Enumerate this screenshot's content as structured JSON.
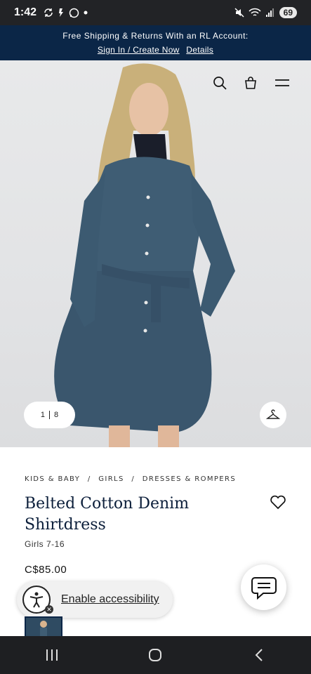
{
  "status_bar": {
    "time": "1:42",
    "battery": "69"
  },
  "promo": {
    "line1": "Free Shipping & Returns With an RL Account:",
    "signin_link": "Sign In / Create Now",
    "details_link": "Details"
  },
  "gallery": {
    "current": "1",
    "total": "8"
  },
  "product": {
    "breadcrumb": [
      "KIDS & BABY",
      "/",
      "GIRLS",
      "/",
      "DRESSES & ROMPERS"
    ],
    "title": "Belted Cotton Denim Shirtdress",
    "size_range": "Girls 7-16",
    "price": "C$85.00"
  },
  "accessibility": {
    "label": "Enable accessibility"
  },
  "colors": {
    "brand_navy": "#0b2647",
    "status_bar": "#222326"
  }
}
